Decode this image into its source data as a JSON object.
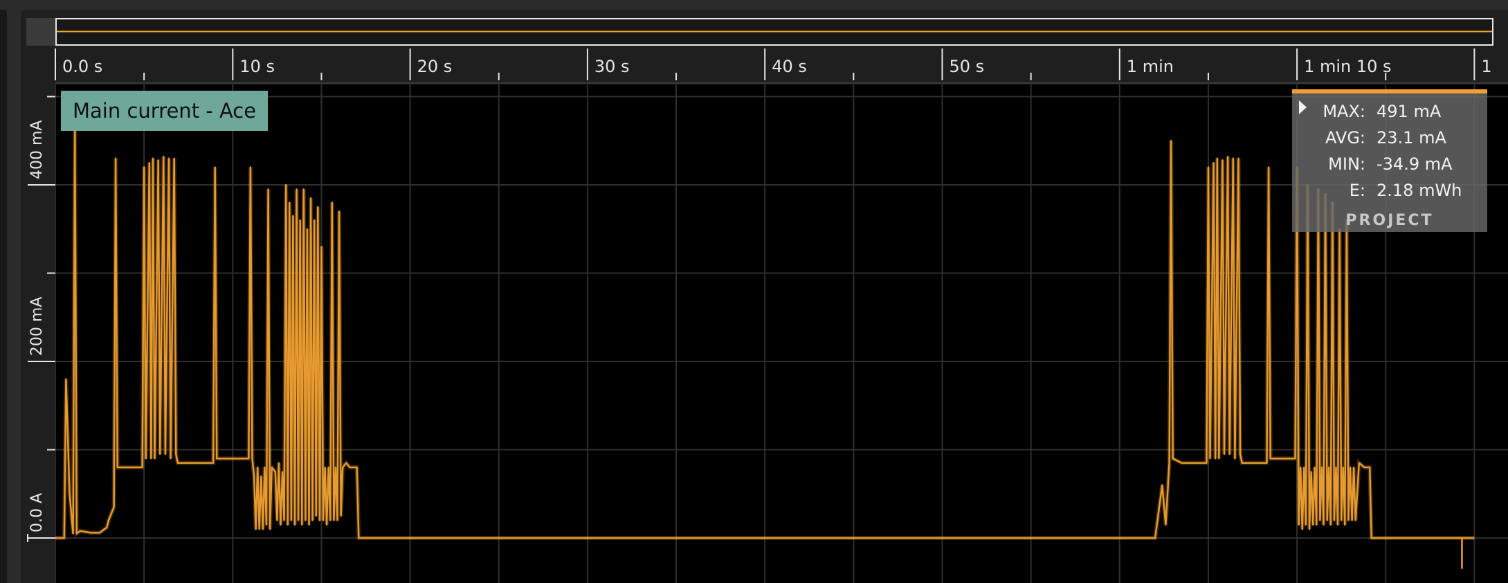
{
  "series_badge": "Main current - Ace",
  "stats": {
    "rows": [
      {
        "label": "MAX:",
        "value": "491 mA"
      },
      {
        "label": "AVG:",
        "value": "23.1 mA"
      },
      {
        "label": "MIN:",
        "value": "-34.9 mA"
      },
      {
        "label": "E:",
        "value": "2.18 mWh"
      }
    ],
    "project_label": "PROJECT"
  },
  "colors": {
    "trace": "#f0a030",
    "badge": "#6fa89b",
    "grid": "#2f2f2f",
    "background": "#000000"
  },
  "icons": {
    "stats_toggle": "triangle-right-icon"
  },
  "chart_data": {
    "type": "line",
    "title": "",
    "xlabel": "",
    "ylabel": "",
    "x_unit": "s",
    "y_unit": "mA",
    "xlim": [
      0,
      80
    ],
    "ylim": [
      -50,
      510
    ],
    "x_ticks": [
      {
        "value": 0,
        "label": "0.0 s"
      },
      {
        "value": 10,
        "label": "10 s"
      },
      {
        "value": 20,
        "label": "20 s"
      },
      {
        "value": 30,
        "label": "30 s"
      },
      {
        "value": 40,
        "label": "40 s"
      },
      {
        "value": 50,
        "label": "50 s"
      },
      {
        "value": 60,
        "label": "1 min"
      },
      {
        "value": 70,
        "label": "1 min 10 s"
      },
      {
        "value": 80,
        "label": "1"
      }
    ],
    "y_ticks": [
      {
        "value": 0,
        "label": "0.0 A"
      },
      {
        "value": 200,
        "label": "200 mA"
      },
      {
        "value": 400,
        "label": "400 mA"
      }
    ],
    "y_minor": [
      100,
      300,
      500
    ],
    "grid": true,
    "series": [
      {
        "values": [
          [
            0.0,
            0
          ],
          [
            0.5,
            0
          ],
          [
            0.6,
            180
          ],
          [
            0.8,
            50
          ],
          [
            1.0,
            5
          ],
          [
            1.1,
            475
          ],
          [
            1.2,
            5
          ],
          [
            1.4,
            8
          ],
          [
            2.0,
            6
          ],
          [
            2.5,
            6
          ],
          [
            2.9,
            12
          ],
          [
            3.0,
            20
          ],
          [
            3.3,
            35
          ],
          [
            3.4,
            430
          ],
          [
            3.5,
            80
          ],
          [
            3.7,
            80
          ],
          [
            4.0,
            80
          ],
          [
            4.9,
            80
          ],
          [
            5.0,
            420
          ],
          [
            5.1,
            90
          ],
          [
            5.3,
            425
          ],
          [
            5.4,
            90
          ],
          [
            5.5,
            430
          ],
          [
            5.6,
            90
          ],
          [
            5.8,
            428
          ],
          [
            5.9,
            95
          ],
          [
            6.1,
            432
          ],
          [
            6.2,
            95
          ],
          [
            6.4,
            430
          ],
          [
            6.5,
            90
          ],
          [
            6.7,
            430
          ],
          [
            6.8,
            95
          ],
          [
            6.9,
            85
          ],
          [
            7.5,
            85
          ],
          [
            8.5,
            85
          ],
          [
            8.9,
            85
          ],
          [
            9.0,
            420
          ],
          [
            9.1,
            90
          ],
          [
            9.5,
            90
          ],
          [
            10.0,
            90
          ],
          [
            10.5,
            90
          ],
          [
            10.9,
            90
          ],
          [
            11.0,
            420
          ],
          [
            11.1,
            90
          ],
          [
            11.2,
            70
          ],
          [
            11.3,
            10
          ],
          [
            11.4,
            80
          ],
          [
            11.5,
            10
          ],
          [
            11.6,
            70
          ],
          [
            11.7,
            10
          ],
          [
            11.8,
            80
          ],
          [
            11.9,
            15
          ],
          [
            12.0,
            395
          ],
          [
            12.1,
            10
          ],
          [
            12.2,
            80
          ],
          [
            12.4,
            75
          ],
          [
            12.5,
            20
          ],
          [
            12.6,
            85
          ],
          [
            12.7,
            15
          ],
          [
            12.8,
            75
          ],
          [
            12.9,
            20
          ],
          [
            13.0,
            400
          ],
          [
            13.1,
            15
          ],
          [
            13.2,
            380
          ],
          [
            13.3,
            20
          ],
          [
            13.4,
            365
          ],
          [
            13.5,
            15
          ],
          [
            13.6,
            395
          ],
          [
            13.7,
            20
          ],
          [
            13.8,
            360
          ],
          [
            13.9,
            15
          ],
          [
            14.0,
            395
          ],
          [
            14.1,
            20
          ],
          [
            14.2,
            350
          ],
          [
            14.3,
            15
          ],
          [
            14.4,
            385
          ],
          [
            14.5,
            20
          ],
          [
            14.6,
            360
          ],
          [
            14.7,
            25
          ],
          [
            14.8,
            375
          ],
          [
            14.9,
            20
          ],
          [
            15.0,
            330
          ],
          [
            15.1,
            20
          ],
          [
            15.2,
            80
          ],
          [
            15.3,
            15
          ],
          [
            15.4,
            80
          ],
          [
            15.5,
            20
          ],
          [
            15.6,
            380
          ],
          [
            15.7,
            20
          ],
          [
            15.8,
            80
          ],
          [
            15.9,
            20
          ],
          [
            16.0,
            370
          ],
          [
            16.1,
            25
          ],
          [
            16.2,
            80
          ],
          [
            16.4,
            85
          ],
          [
            16.6,
            80
          ],
          [
            16.8,
            80
          ],
          [
            17.0,
            80
          ],
          [
            17.1,
            0
          ],
          [
            17.5,
            0
          ],
          [
            20,
            0
          ],
          [
            30,
            0
          ],
          [
            40,
            0
          ],
          [
            50,
            0
          ],
          [
            60,
            0
          ],
          [
            62.0,
            0
          ],
          [
            62.2,
            30
          ],
          [
            62.4,
            60
          ],
          [
            62.6,
            15
          ],
          [
            62.8,
            85
          ],
          [
            62.9,
            450
          ],
          [
            63.0,
            90
          ],
          [
            63.5,
            85
          ],
          [
            64.0,
            85
          ],
          [
            64.5,
            85
          ],
          [
            64.9,
            85
          ],
          [
            65.0,
            420
          ],
          [
            65.1,
            90
          ],
          [
            65.3,
            425
          ],
          [
            65.4,
            90
          ],
          [
            65.5,
            430
          ],
          [
            65.6,
            90
          ],
          [
            65.8,
            428
          ],
          [
            65.9,
            95
          ],
          [
            66.1,
            432
          ],
          [
            66.2,
            95
          ],
          [
            66.4,
            430
          ],
          [
            66.5,
            90
          ],
          [
            66.7,
            430
          ],
          [
            66.8,
            95
          ],
          [
            66.9,
            85
          ],
          [
            67.5,
            85
          ],
          [
            68.3,
            85
          ],
          [
            68.4,
            420
          ],
          [
            68.5,
            90
          ],
          [
            69.0,
            90
          ],
          [
            69.5,
            90
          ],
          [
            69.9,
            90
          ],
          [
            70.0,
            420
          ],
          [
            70.1,
            15
          ],
          [
            70.2,
            80
          ],
          [
            70.3,
            10
          ],
          [
            70.4,
            80
          ],
          [
            70.5,
            15
          ],
          [
            70.6,
            400
          ],
          [
            70.7,
            10
          ],
          [
            70.8,
            75
          ],
          [
            70.9,
            15
          ],
          [
            71.0,
            80
          ],
          [
            71.1,
            15
          ],
          [
            71.2,
            395
          ],
          [
            71.3,
            20
          ],
          [
            71.4,
            80
          ],
          [
            71.5,
            15
          ],
          [
            71.6,
            390
          ],
          [
            71.7,
            20
          ],
          [
            71.8,
            80
          ],
          [
            71.9,
            15
          ],
          [
            72.0,
            380
          ],
          [
            72.1,
            20
          ],
          [
            72.2,
            80
          ],
          [
            72.3,
            15
          ],
          [
            72.4,
            350
          ],
          [
            72.5,
            20
          ],
          [
            72.6,
            80
          ],
          [
            72.7,
            15
          ],
          [
            72.8,
            360
          ],
          [
            72.9,
            20
          ],
          [
            73.0,
            80
          ],
          [
            73.1,
            20
          ],
          [
            73.2,
            80
          ],
          [
            73.3,
            20
          ],
          [
            73.5,
            85
          ],
          [
            73.8,
            80
          ],
          [
            74.1,
            80
          ],
          [
            74.2,
            0
          ],
          [
            75.0,
            0
          ],
          [
            78.0,
            0
          ],
          [
            80.0,
            0
          ]
        ]
      }
    ]
  }
}
